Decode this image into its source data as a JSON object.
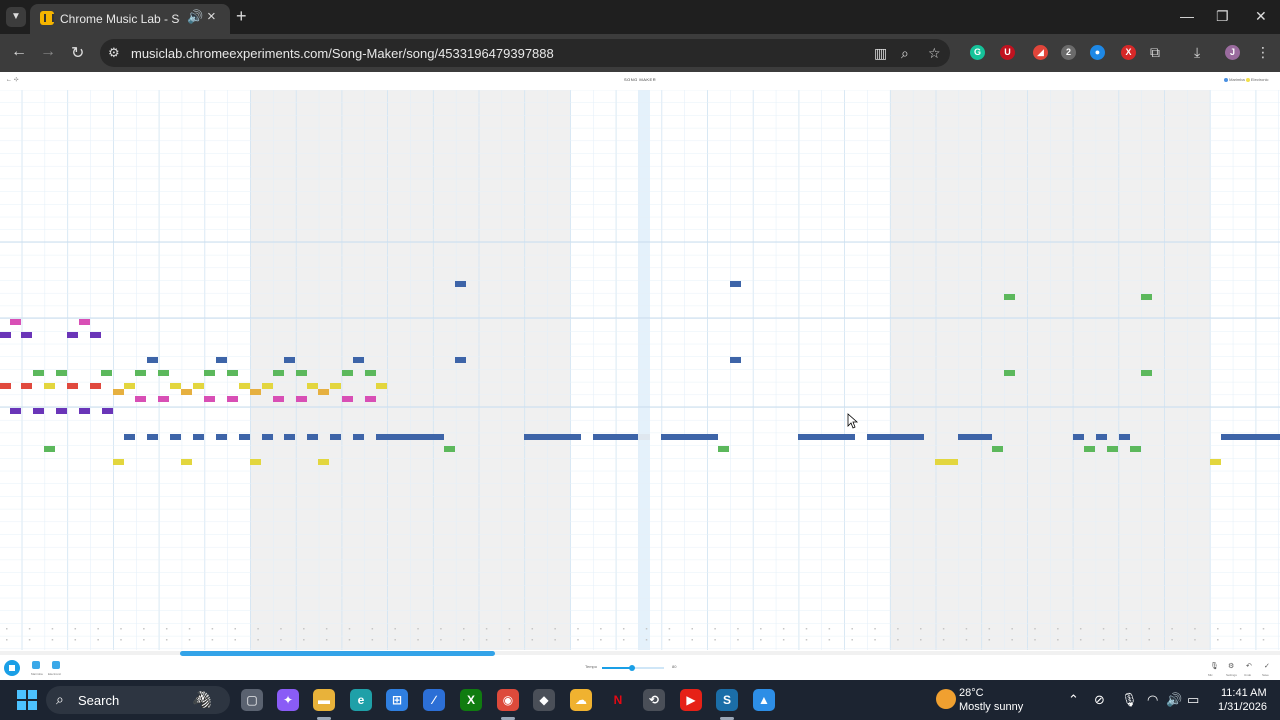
{
  "browser": {
    "tab_title": "Chrome Music Lab - Song M",
    "url": "musiclab.chromeexperiments.com/Song-Maker/song/4533196479397888",
    "tab_dropdown_icon": "chevron-down-icon",
    "new_tab_icon": "plus-icon",
    "extensions": [
      {
        "name": "grammarly",
        "glyph": "G",
        "color": "#15c39a"
      },
      {
        "name": "ublock",
        "glyph": "U",
        "color": "#c1121f"
      },
      {
        "name": "extension-red",
        "glyph": "◢",
        "color": "#e0453a"
      },
      {
        "name": "extension-badge",
        "glyph": "2",
        "color": "#6b6b6b"
      },
      {
        "name": "extension-globe",
        "glyph": "●",
        "color": "#1e88e5"
      },
      {
        "name": "extension-x",
        "glyph": "X",
        "color": "#d62828"
      }
    ]
  },
  "app": {
    "header_left": "← ⊹",
    "title": "SONG MAKER",
    "legend": [
      {
        "label": "Marimba",
        "color": "#4a90e2"
      },
      {
        "label": "Electronic",
        "color": "#f2e04a"
      }
    ],
    "controls": {
      "left": [
        {
          "name": "instrument-button",
          "label": "Marimba"
        },
        {
          "name": "percussion-button",
          "label": "Electronic"
        }
      ],
      "tempo_label": "Tempo",
      "tempo_value": "80",
      "tempo_fraction": 0.48,
      "right": [
        {
          "name": "mic-button",
          "glyph": "🎙",
          "label": "Mic"
        },
        {
          "name": "settings-button",
          "glyph": "⚙",
          "label": "Settings"
        },
        {
          "name": "undo-button",
          "glyph": "↶",
          "label": "Undo"
        },
        {
          "name": "save-button",
          "glyph": "✓",
          "label": "Save"
        }
      ]
    }
  },
  "colors": {
    "blue": "#3d64a8",
    "green": "#5cb85c",
    "yellow": "#e3d63e",
    "orange": "#e6b040",
    "pink": "#d84fb5",
    "purple": "#6a35b8",
    "red": "#e0493e",
    "shade": "#f0f0f0",
    "playhead": "#e4f1fb"
  },
  "taskbar": {
    "search_placeholder": "Search",
    "weather_temp": "28°C",
    "weather_desc": "Mostly sunny",
    "time": "11:41 AM",
    "date": "1/31/2026",
    "apps": [
      {
        "name": "task-view",
        "glyph": "▢",
        "color": "#5a6270"
      },
      {
        "name": "copilot",
        "glyph": "✦",
        "color": "#8a5cf6"
      },
      {
        "name": "file-explorer",
        "glyph": "▬",
        "color": "#e8b23a"
      },
      {
        "name": "edge",
        "glyph": "e",
        "color": "#1fa0a8"
      },
      {
        "name": "microsoft-store",
        "glyph": "⊞",
        "color": "#2f7fe0"
      },
      {
        "name": "visual-studio",
        "glyph": "∕",
        "color": "#2c6fd6"
      },
      {
        "name": "xbox",
        "glyph": "X",
        "color": "#107c10"
      },
      {
        "name": "chrome",
        "glyph": "◉",
        "color": "#dd4a3b"
      },
      {
        "name": "unity",
        "glyph": "◆",
        "color": "#4a4f58"
      },
      {
        "name": "cloud-app",
        "glyph": "☁",
        "color": "#f0b230"
      },
      {
        "name": "netflix",
        "glyph": "N",
        "color": "#1c2431"
      },
      {
        "name": "steam-app",
        "glyph": "⟲",
        "color": "#4a4f58"
      },
      {
        "name": "youtube",
        "glyph": "▶",
        "color": "#e62117"
      },
      {
        "name": "steam",
        "glyph": "S",
        "color": "#1b6ea8"
      },
      {
        "name": "photos",
        "glyph": "▲",
        "color": "#2d8ee6"
      }
    ]
  }
}
